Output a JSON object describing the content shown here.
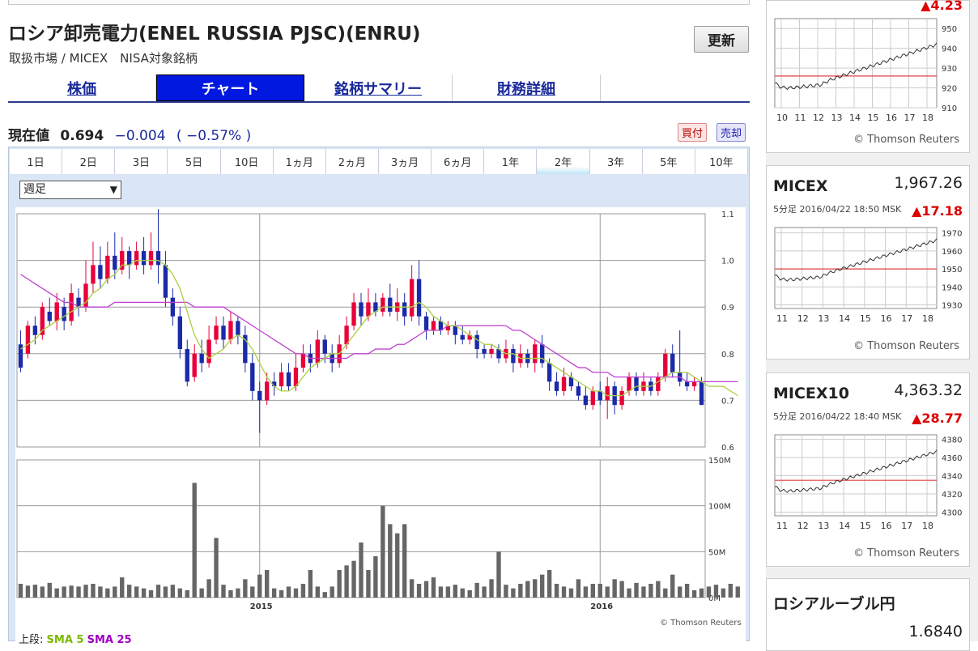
{
  "stock": {
    "title": "ロシア卸売電力(ENEL RUSSIA PJSC)(ENRU)",
    "subtitle": "取扱市場 / MICEX　NISA対象銘柄",
    "refresh": "更新"
  },
  "tabs": [
    {
      "label": "株価",
      "active": false
    },
    {
      "label": "チャート",
      "active": true
    },
    {
      "label": "銘柄サマリー",
      "active": false
    },
    {
      "label": "財務詳細",
      "active": false
    }
  ],
  "price": {
    "label": "現在値",
    "value": "0.694",
    "change": "−0.004",
    "pct": "( −0.57% )",
    "buy": "買付",
    "sell": "売却"
  },
  "periods": [
    "1日",
    "2日",
    "3日",
    "5日",
    "10日",
    "1ヵ月",
    "2ヵ月",
    "3ヵ月",
    "6ヵ月",
    "1年",
    "2年",
    "3年",
    "5年",
    "10年"
  ],
  "active_period": "2年",
  "interval_select": "週足",
  "chart_credit": "© Thomson Reuters",
  "legend": {
    "prefix": "上段:",
    "sma5": "SMA 5",
    "sma25": "SMA 25"
  },
  "colors": {
    "up": "#e8003a",
    "down": "#1a2aa8",
    "sma5": "#a8d040",
    "sma25": "#c040d0",
    "volume": "#666666",
    "ref_line": "#e04040"
  },
  "chart_data": {
    "type": "candlestick",
    "price_axis": {
      "ticks": [
        "1.1",
        "1.0",
        "0.9",
        "0.8",
        "0.7",
        "0.6"
      ],
      "range": [
        0.6,
        1.1
      ]
    },
    "volume_axis": {
      "ticks": [
        "150M",
        "100M",
        "50M",
        "0M"
      ],
      "range": [
        0,
        150
      ]
    },
    "x_labels": [
      "2015",
      "2016"
    ],
    "candles": [
      [
        0.82,
        0.77,
        0.85,
        0.76
      ],
      [
        0.8,
        0.86,
        0.87,
        0.79
      ],
      [
        0.86,
        0.84,
        0.88,
        0.82
      ],
      [
        0.84,
        0.9,
        0.91,
        0.83
      ],
      [
        0.89,
        0.87,
        0.92,
        0.86
      ],
      [
        0.87,
        0.91,
        0.93,
        0.85
      ],
      [
        0.9,
        0.87,
        0.92,
        0.85
      ],
      [
        0.87,
        0.93,
        0.95,
        0.86
      ],
      [
        0.92,
        0.9,
        0.94,
        0.88
      ],
      [
        0.9,
        0.95,
        1.0,
        0.89
      ],
      [
        0.95,
        0.99,
        1.04,
        0.93
      ],
      [
        0.99,
        0.96,
        1.03,
        0.94
      ],
      [
        0.96,
        1.01,
        1.04,
        0.95
      ],
      [
        1.01,
        0.98,
        1.06,
        0.96
      ],
      [
        0.98,
        1.02,
        1.05,
        0.97
      ],
      [
        1.02,
        0.99,
        1.03,
        0.96
      ],
      [
        0.99,
        1.02,
        1.04,
        0.98
      ],
      [
        1.02,
        0.99,
        1.05,
        0.97
      ],
      [
        0.99,
        1.02,
        1.06,
        0.98
      ],
      [
        1.02,
        0.99,
        1.11,
        0.95
      ],
      [
        0.99,
        0.92,
        1.02,
        0.9
      ],
      [
        0.92,
        0.88,
        0.94,
        0.86
      ],
      [
        0.88,
        0.81,
        0.9,
        0.79
      ],
      [
        0.81,
        0.74,
        0.83,
        0.73
      ],
      [
        0.75,
        0.8,
        0.82,
        0.74
      ],
      [
        0.8,
        0.78,
        0.83,
        0.76
      ],
      [
        0.78,
        0.83,
        0.86,
        0.77
      ],
      [
        0.83,
        0.86,
        0.88,
        0.82
      ],
      [
        0.86,
        0.83,
        0.88,
        0.81
      ],
      [
        0.83,
        0.87,
        0.89,
        0.82
      ],
      [
        0.87,
        0.84,
        0.88,
        0.82
      ],
      [
        0.84,
        0.78,
        0.86,
        0.76
      ],
      [
        0.78,
        0.72,
        0.8,
        0.7
      ],
      [
        0.72,
        0.7,
        0.74,
        0.63
      ],
      [
        0.7,
        0.74,
        0.76,
        0.69
      ],
      [
        0.74,
        0.73,
        0.76,
        0.71
      ],
      [
        0.73,
        0.76,
        0.78,
        0.72
      ],
      [
        0.76,
        0.73,
        0.78,
        0.72
      ],
      [
        0.73,
        0.77,
        0.8,
        0.72
      ],
      [
        0.77,
        0.8,
        0.82,
        0.76
      ],
      [
        0.8,
        0.78,
        0.82,
        0.76
      ],
      [
        0.78,
        0.83,
        0.85,
        0.77
      ],
      [
        0.83,
        0.8,
        0.84,
        0.78
      ],
      [
        0.8,
        0.78,
        0.82,
        0.76
      ],
      [
        0.78,
        0.82,
        0.84,
        0.77
      ],
      [
        0.82,
        0.86,
        0.88,
        0.81
      ],
      [
        0.86,
        0.91,
        0.93,
        0.85
      ],
      [
        0.91,
        0.88,
        0.93,
        0.86
      ],
      [
        0.88,
        0.91,
        0.94,
        0.87
      ],
      [
        0.91,
        0.89,
        0.93,
        0.88
      ],
      [
        0.89,
        0.92,
        0.93,
        0.88
      ],
      [
        0.92,
        0.89,
        0.95,
        0.88
      ],
      [
        0.89,
        0.91,
        0.94,
        0.87
      ],
      [
        0.91,
        0.88,
        0.93,
        0.86
      ],
      [
        0.88,
        0.96,
        0.99,
        0.87
      ],
      [
        0.96,
        0.88,
        1.0,
        0.86
      ],
      [
        0.88,
        0.85,
        0.89,
        0.83
      ],
      [
        0.85,
        0.87,
        0.88,
        0.84
      ],
      [
        0.87,
        0.85,
        0.88,
        0.84
      ],
      [
        0.85,
        0.86,
        0.87,
        0.84
      ],
      [
        0.86,
        0.84,
        0.87,
        0.82
      ],
      [
        0.84,
        0.83,
        0.86,
        0.82
      ],
      [
        0.83,
        0.84,
        0.85,
        0.82
      ],
      [
        0.84,
        0.81,
        0.85,
        0.79
      ],
      [
        0.81,
        0.8,
        0.82,
        0.79
      ],
      [
        0.8,
        0.81,
        0.82,
        0.79
      ],
      [
        0.81,
        0.79,
        0.82,
        0.78
      ],
      [
        0.79,
        0.81,
        0.83,
        0.78
      ],
      [
        0.81,
        0.78,
        0.82,
        0.76
      ],
      [
        0.78,
        0.8,
        0.82,
        0.77
      ],
      [
        0.8,
        0.78,
        0.81,
        0.77
      ],
      [
        0.78,
        0.82,
        0.83,
        0.76
      ],
      [
        0.82,
        0.78,
        0.84,
        0.77
      ],
      [
        0.78,
        0.74,
        0.79,
        0.72
      ],
      [
        0.74,
        0.72,
        0.76,
        0.71
      ],
      [
        0.72,
        0.75,
        0.77,
        0.71
      ],
      [
        0.75,
        0.73,
        0.76,
        0.72
      ],
      [
        0.73,
        0.71,
        0.74,
        0.7
      ],
      [
        0.71,
        0.69,
        0.73,
        0.68
      ],
      [
        0.69,
        0.72,
        0.73,
        0.68
      ],
      [
        0.72,
        0.7,
        0.74,
        0.69
      ],
      [
        0.7,
        0.73,
        0.75,
        0.66
      ],
      [
        0.73,
        0.69,
        0.74,
        0.67
      ],
      [
        0.69,
        0.72,
        0.73,
        0.68
      ],
      [
        0.72,
        0.75,
        0.76,
        0.71
      ],
      [
        0.75,
        0.72,
        0.76,
        0.71
      ],
      [
        0.72,
        0.74,
        0.76,
        0.71
      ],
      [
        0.74,
        0.72,
        0.75,
        0.71
      ],
      [
        0.72,
        0.75,
        0.76,
        0.71
      ],
      [
        0.75,
        0.8,
        0.81,
        0.74
      ],
      [
        0.8,
        0.76,
        0.82,
        0.75
      ],
      [
        0.76,
        0.74,
        0.85,
        0.73
      ],
      [
        0.74,
        0.73,
        0.76,
        0.72
      ],
      [
        0.73,
        0.74,
        0.75,
        0.72
      ],
      [
        0.74,
        0.69,
        0.75,
        0.69
      ]
    ],
    "volume": [
      15,
      13,
      14,
      12,
      16,
      10,
      12,
      13,
      12,
      14,
      15,
      12,
      10,
      12,
      22,
      14,
      12,
      10,
      8,
      14,
      12,
      14,
      10,
      8,
      125,
      10,
      20,
      65,
      14,
      8,
      10,
      20,
      12,
      25,
      30,
      10,
      8,
      12,
      10,
      15,
      30,
      12,
      6,
      12,
      30,
      35,
      40,
      60,
      30,
      45,
      100,
      80,
      70,
      80,
      20,
      15,
      18,
      22,
      12,
      12,
      14,
      10,
      8,
      16,
      12,
      20,
      50,
      14,
      10,
      15,
      18,
      20,
      25,
      30,
      15,
      12,
      10,
      20,
      12,
      15,
      15,
      12,
      20,
      18,
      10,
      16,
      12,
      15,
      18,
      10,
      25,
      12,
      15,
      8,
      10,
      12,
      14,
      10,
      15,
      12
    ],
    "sma5": [
      0.81,
      0.82,
      0.83,
      0.85,
      0.86,
      0.87,
      0.88,
      0.89,
      0.9,
      0.91,
      0.93,
      0.94,
      0.96,
      0.97,
      0.99,
      0.99,
      1.0,
      1.0,
      1.0,
      1.0,
      0.99,
      0.97,
      0.94,
      0.89,
      0.84,
      0.81,
      0.79,
      0.8,
      0.81,
      0.83,
      0.84,
      0.83,
      0.81,
      0.78,
      0.75,
      0.73,
      0.72,
      0.72,
      0.73,
      0.75,
      0.77,
      0.78,
      0.79,
      0.8,
      0.8,
      0.82,
      0.84,
      0.86,
      0.88,
      0.89,
      0.9,
      0.9,
      0.9,
      0.9,
      0.9,
      0.91,
      0.9,
      0.88,
      0.87,
      0.86,
      0.86,
      0.85,
      0.84,
      0.83,
      0.82,
      0.82,
      0.81,
      0.8,
      0.8,
      0.79,
      0.79,
      0.79,
      0.79,
      0.78,
      0.77,
      0.76,
      0.75,
      0.74,
      0.73,
      0.72,
      0.72,
      0.71,
      0.71,
      0.71,
      0.72,
      0.73,
      0.73,
      0.73,
      0.74,
      0.75,
      0.76,
      0.76,
      0.76,
      0.75,
      0.74,
      0.73,
      0.73,
      0.73,
      0.72,
      0.71
    ],
    "sma25": [
      0.97,
      0.96,
      0.95,
      0.94,
      0.93,
      0.92,
      0.91,
      0.91,
      0.9,
      0.9,
      0.9,
      0.9,
      0.9,
      0.91,
      0.91,
      0.91,
      0.91,
      0.91,
      0.91,
      0.91,
      0.91,
      0.91,
      0.91,
      0.91,
      0.9,
      0.9,
      0.9,
      0.9,
      0.9,
      0.89,
      0.88,
      0.87,
      0.86,
      0.85,
      0.84,
      0.83,
      0.82,
      0.81,
      0.8,
      0.8,
      0.79,
      0.79,
      0.79,
      0.79,
      0.79,
      0.79,
      0.8,
      0.8,
      0.8,
      0.81,
      0.81,
      0.81,
      0.82,
      0.82,
      0.83,
      0.84,
      0.85,
      0.85,
      0.85,
      0.86,
      0.86,
      0.86,
      0.86,
      0.86,
      0.86,
      0.86,
      0.86,
      0.86,
      0.85,
      0.85,
      0.84,
      0.83,
      0.82,
      0.81,
      0.8,
      0.79,
      0.78,
      0.77,
      0.77,
      0.76,
      0.76,
      0.76,
      0.75,
      0.75,
      0.75,
      0.75,
      0.75,
      0.75,
      0.75,
      0.75,
      0.75,
      0.75,
      0.74,
      0.74,
      0.74,
      0.74,
      0.74,
      0.74,
      0.74,
      0.74
    ]
  },
  "sidebar": {
    "cards": [
      {
        "name": "",
        "value": "",
        "ts": "",
        "change": "▲4.23",
        "ticks": [
          "950",
          "940",
          "930",
          "920",
          "910"
        ],
        "range": [
          910,
          955
        ],
        "ref": 926,
        "x_labels": [
          "10",
          "11",
          "12",
          "13",
          "14",
          "15",
          "16",
          "17",
          "18"
        ],
        "credit": "© Thomson Reuters"
      },
      {
        "name": "MICEX",
        "value": "1,967.26",
        "ts": "5分足 2016/04/22 18:50 MSK",
        "change": "▲17.18",
        "ticks": [
          "1970",
          "1960",
          "1950",
          "1940",
          "1930"
        ],
        "range": [
          1928,
          1973
        ],
        "ref": 1950,
        "x_labels": [
          "11",
          "12",
          "13",
          "14",
          "15",
          "16",
          "17",
          "18"
        ],
        "credit": "© Thomson Reuters"
      },
      {
        "name": "MICEX10",
        "value": "4,363.32",
        "ts": "5分足 2016/04/22 18:40 MSK",
        "change": "▲28.77",
        "ticks": [
          "4380",
          "4360",
          "4340",
          "4320",
          "4300"
        ],
        "range": [
          4296,
          4385
        ],
        "ref": 4335,
        "x_labels": [
          "11",
          "12",
          "13",
          "14",
          "15",
          "16",
          "17",
          "18"
        ],
        "credit": "© Thomson Reuters"
      }
    ],
    "ruble": {
      "name": "ロシアルーブル円",
      "value": "1.6840"
    }
  }
}
